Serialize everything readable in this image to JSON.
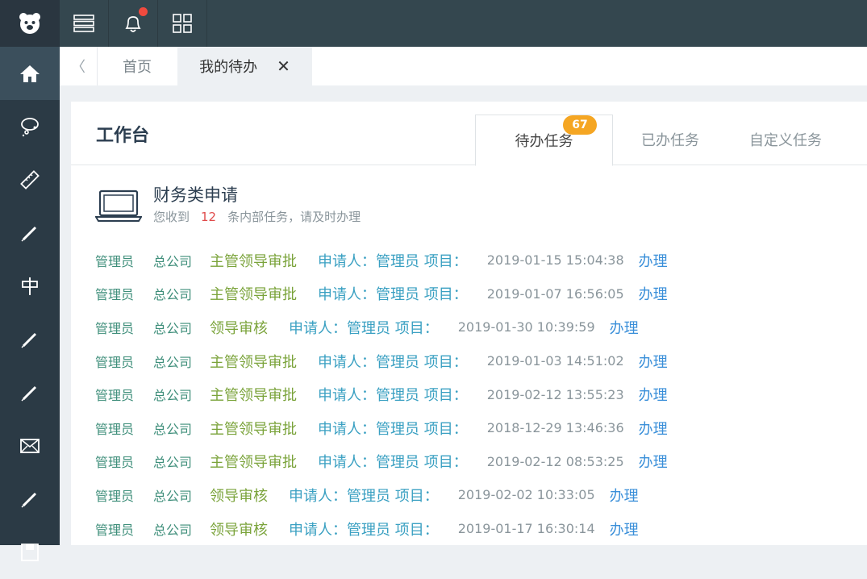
{
  "breadcrumb_tabs": {
    "back": "〈",
    "home": "首页",
    "active": "我的待办",
    "close": "✕"
  },
  "workbench": {
    "title": "工作台"
  },
  "tabs": {
    "todo": "待办任务",
    "todo_count": "67",
    "done": "已办任务",
    "custom": "自定义任务"
  },
  "section": {
    "title": "财务类申请",
    "sub_prefix": "您收到",
    "count": "12",
    "sub_suffix": "条内部任务，请及时办理"
  },
  "rows": [
    {
      "user": "管理员",
      "org": "总公司",
      "step": "主管领导审批",
      "applicant": "申请人：管理员 项目：",
      "time": "2019-01-15 15:04:38",
      "action": "办理"
    },
    {
      "user": "管理员",
      "org": "总公司",
      "step": "主管领导审批",
      "applicant": "申请人：管理员 项目：",
      "time": "2019-01-07 16:56:05",
      "action": "办理"
    },
    {
      "user": "管理员",
      "org": "总公司",
      "step": "领导审核",
      "applicant": "申请人：管理员 项目：",
      "time": "2019-01-30 10:39:59",
      "action": "办理"
    },
    {
      "user": "管理员",
      "org": "总公司",
      "step": "主管领导审批",
      "applicant": "申请人：管理员 项目：",
      "time": "2019-01-03 14:51:02",
      "action": "办理"
    },
    {
      "user": "管理员",
      "org": "总公司",
      "step": "主管领导审批",
      "applicant": "申请人：管理员 项目：",
      "time": "2019-02-12 13:55:23",
      "action": "办理"
    },
    {
      "user": "管理员",
      "org": "总公司",
      "step": "主管领导审批",
      "applicant": "申请人：管理员 项目：",
      "time": "2018-12-29 13:46:36",
      "action": "办理"
    },
    {
      "user": "管理员",
      "org": "总公司",
      "step": "主管领导审批",
      "applicant": "申请人：管理员 项目：",
      "time": "2019-02-12 08:53:25",
      "action": "办理"
    },
    {
      "user": "管理员",
      "org": "总公司",
      "step": "领导审核",
      "applicant": "申请人：管理员 项目：",
      "time": "2019-02-02 10:33:05",
      "action": "办理"
    },
    {
      "user": "管理员",
      "org": "总公司",
      "step": "领导审核",
      "applicant": "申请人：管理员 项目：",
      "time": "2019-01-17 16:30:14",
      "action": "办理"
    }
  ],
  "colors": {
    "sidebar": "#2b3a45",
    "topbar": "#34474f",
    "badge": "#f5a623",
    "notification_dot": "#f04a3e",
    "action_link": "#3a8fd9"
  },
  "icons": {
    "sidebar": [
      "home-icon",
      "chat-icon",
      "ruler-icon",
      "pen-icon",
      "sign-icon",
      "pen-icon",
      "pen-icon",
      "mail-icon",
      "pen-icon",
      "save-icon"
    ],
    "topbar": [
      "list-icon",
      "bell-icon",
      "grid-icon"
    ]
  }
}
